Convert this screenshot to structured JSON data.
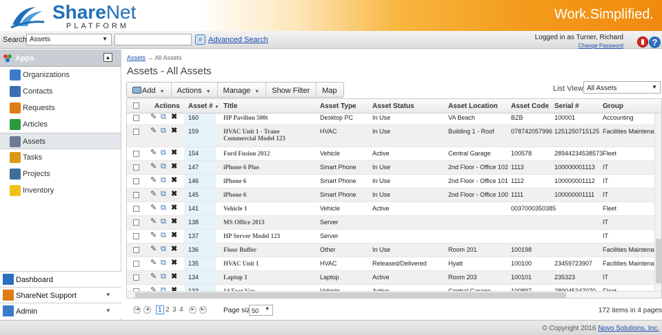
{
  "header": {
    "logo_share": "Share",
    "logo_net": "Net",
    "logo_platform": "PLATFORM",
    "tagline": "Work.Simplified."
  },
  "topbar": {
    "search_label": "Search",
    "search_select_value": "Assets",
    "search_input_value": "",
    "advanced_search": "Advanced Search",
    "logged_in": "Logged in as  Turner, Richard",
    "change_password": "Change Password",
    "help_glyph": "?"
  },
  "sidebar": {
    "apps_label": "Apps",
    "items": [
      {
        "label": "Organizations",
        "icon": "organizations-icon",
        "color": "#3a7cc8"
      },
      {
        "label": "Contacts",
        "icon": "contacts-icon",
        "color": "#3a6fb0"
      },
      {
        "label": "Requests",
        "icon": "requests-icon",
        "color": "#e07b1a"
      },
      {
        "label": "Articles",
        "icon": "articles-icon",
        "color": "#2e9a3e"
      },
      {
        "label": "Assets",
        "icon": "assets-icon",
        "color": "#6b7b92"
      },
      {
        "label": "Tasks",
        "icon": "tasks-icon",
        "color": "#d99a18"
      },
      {
        "label": "Projects",
        "icon": "projects-icon",
        "color": "#3b6f9a"
      },
      {
        "label": "Inventory",
        "icon": "inventory-icon",
        "color": "#f2c21a"
      }
    ],
    "active_index": 4,
    "bottom": [
      {
        "label": "Dashboard",
        "icon": "dashboard-icon",
        "chevron": ""
      },
      {
        "label": "ShareNet Support",
        "icon": "support-icon",
        "chevron": "▼"
      },
      {
        "label": "Admin",
        "icon": "admin-icon",
        "chevron": "▼"
      }
    ]
  },
  "main": {
    "breadcrumb_link": "Assets",
    "breadcrumb_arrow": "→",
    "breadcrumb_current": "All Assets",
    "title": "Assets - All Assets",
    "toolbar": {
      "add": "Add",
      "actions": "Actions",
      "manage": "Manage",
      "show_filter": "Show Filter",
      "map": "Map"
    },
    "list_view_label": "List View",
    "list_view_value": "All Assets"
  },
  "grid": {
    "columns": [
      "Actions",
      "Asset #",
      "Title",
      "Asset Type",
      "Asset Status",
      "Asset Location",
      "Asset Code",
      "Serial #",
      "Group"
    ],
    "sort_indicator": "▼",
    "rows": [
      {
        "asset": "160",
        "title": "HP Pavilion 500t",
        "type": "Desktop PC",
        "status": "In Use",
        "location": "VA Beach",
        "code": "BZB",
        "serial": "100001",
        "group": "Accounting"
      },
      {
        "asset": "159",
        "title": "HVAC Unit 1 - Trane Commercial Model 123",
        "type": "HVAC",
        "status": "In Use",
        "location": "Building 1 - Roof",
        "code": "078742057996",
        "serial": "1251250715125",
        "group": "Facilities Maintenance"
      },
      {
        "asset": "154",
        "title": "Ford Fusion 2012",
        "type": "Vehicle",
        "status": "Active",
        "location": "Central Garage",
        "code": "100578",
        "serial": "28944234538573",
        "group": "Fleet"
      },
      {
        "asset": "147",
        "title": "iPhone 6 Plus",
        "type": "Smart Phone",
        "status": "In Use",
        "location": "2nd Floor - Office 102",
        "code": "1113",
        "serial": "100000001113",
        "group": "IT"
      },
      {
        "asset": "146",
        "title": "iPhone 6",
        "type": "Smart Phone",
        "status": "In Use",
        "location": "2nd Floor - Office 101",
        "code": "1112",
        "serial": "100000001112",
        "group": "IT"
      },
      {
        "asset": "145",
        "title": "iPhone 6",
        "type": "Smart Phone",
        "status": "In Use",
        "location": "2nd Floor - Office 100",
        "code": "1111",
        "serial": "100000001111",
        "group": "IT"
      },
      {
        "asset": "141",
        "title": "Vehicle 1",
        "type": "Vehicle",
        "status": "Active",
        "location": "",
        "code": "0037000350385",
        "serial": "",
        "group": "Fleet"
      },
      {
        "asset": "138",
        "title": "MS Office 2013",
        "type": "Server",
        "status": "",
        "location": "",
        "code": "",
        "serial": "",
        "group": "IT"
      },
      {
        "asset": "137",
        "title": "HP Server Model 123",
        "type": "Server",
        "status": "",
        "location": "",
        "code": "",
        "serial": "",
        "group": "IT"
      },
      {
        "asset": "136",
        "title": "Floor Buffer",
        "type": "Other",
        "status": "In Use",
        "location": "Room 201",
        "code": "100198",
        "serial": "",
        "group": "Facilities Maintenance"
      },
      {
        "asset": "135",
        "title": "HVAC Unit 1",
        "type": "HVAC",
        "status": "Released/Delivered",
        "location": "Hyatt",
        "code": "100100",
        "serial": "23459723907",
        "group": "Facilities Maintenance"
      },
      {
        "asset": "134",
        "title": "Laptop 1",
        "type": "Laptop",
        "status": "Active",
        "location": "Room 203",
        "code": "100101",
        "serial": "235323",
        "group": "IT"
      },
      {
        "asset": "133",
        "title": "14 Foot Van",
        "type": "Vehicle",
        "status": "Active",
        "location": "Central Garage",
        "code": "100897",
        "serial": "289045347070",
        "group": "Fleet"
      }
    ]
  },
  "pager": {
    "pages": [
      "1",
      "2",
      "3",
      "4"
    ],
    "current": "1",
    "page_size_label": "Page size:",
    "page_size": "50",
    "items_info": "172 items in 4 pages"
  },
  "footer": {
    "copyright_text": "© Copyright 2016 ",
    "company": "Novo Solutions, Inc."
  }
}
